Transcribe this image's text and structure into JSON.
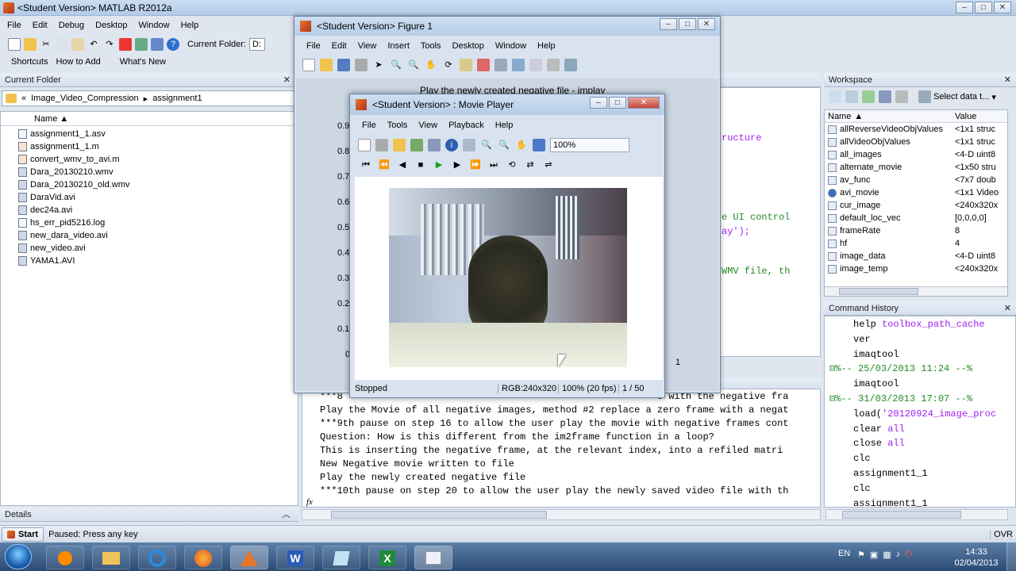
{
  "app": {
    "title": "<Student Version> MATLAB  R2012a"
  },
  "main_menu": [
    "File",
    "Edit",
    "Debug",
    "Desktop",
    "Window",
    "Help"
  ],
  "toolbar": {
    "current_folder_label": "Current Folder:",
    "current_folder_value": "D:"
  },
  "shortcuts": {
    "shortcuts_label": "Shortcuts",
    "how_to_add": "How to Add",
    "whats_new": "What's New"
  },
  "current_folder": {
    "title": "Current Folder",
    "path": [
      "Image_Video_Compression",
      "assignment1"
    ],
    "column_name": "Name",
    "files": [
      "assignment1_1.asv",
      "assignment1_1.m",
      "convert_wmv_to_avi.m",
      "Dara_20130210.wmv",
      "Dara_20130210_old.wmv",
      "DaraVid.avi",
      "dec24a.avi",
      "hs_err_pid5216.log",
      "new_dara_video.avi",
      "new_video.avi",
      "YAMA1.AVI"
    ],
    "details_label": "Details"
  },
  "figure": {
    "title": "<Student Version> Figure 1",
    "menu": [
      "File",
      "Edit",
      "View",
      "Insert",
      "Tools",
      "Desktop",
      "Window",
      "Help"
    ],
    "plot_title": "Play the newly created negative file - implay",
    "yticks": [
      "0.9",
      "0.8",
      "0.7",
      "0.6",
      "0.5",
      "0.4",
      "0.3",
      "0.2",
      "0.1",
      "0"
    ],
    "xtick_last": "1"
  },
  "movie_player": {
    "title": "<Student Version> : Movie Player",
    "menu": [
      "File",
      "Tools",
      "View",
      "Playback",
      "Help"
    ],
    "zoom": "100%",
    "status": "Stopped",
    "rgb": "RGB:240x320",
    "rate": "100% (20 fps)",
    "frame": "1 / 50"
  },
  "editor_fragments": [
    "ructure",
    "e UI control",
    "ay');",
    "WMV file, th"
  ],
  "command_window": {
    "lines": [
      "***8",
      "Play the Movie of all negative images, method #2 replace a zero frame with a negat",
      "***9th pause on step 16 to allow the user play the movie with negative frames cont",
      "Question: How is this different from the im2frame function in a loop?",
      "This is inserting the negative frame, at the relevant index, into a refiled matri",
      "New Negative movie written to file",
      "Play the newly created negative file",
      "***10th pause on step 20 to allow the user play the newly saved video file with th"
    ],
    "line0_tail": "e with the negative fra",
    "fx": "fx"
  },
  "workspace": {
    "title": "Workspace",
    "select_data": "Select data t...",
    "col_name": "Name",
    "col_value": "Value",
    "rows": [
      {
        "name": "allReverseVideoObjValues",
        "value": "<1x1 struc"
      },
      {
        "name": "allVideoObjValues",
        "value": "<1x1 struc"
      },
      {
        "name": "all_images",
        "value": "<4-D uint8"
      },
      {
        "name": "alternate_movie",
        "value": "<1x50 stru"
      },
      {
        "name": "av_func",
        "value": "<7x7 doub"
      },
      {
        "name": "avi_movie",
        "value": "<1x1 Video"
      },
      {
        "name": "cur_image",
        "value": "<240x320x"
      },
      {
        "name": "default_loc_vec",
        "value": "[0,0,0,0]"
      },
      {
        "name": "frameRate",
        "value": "8"
      },
      {
        "name": "hf",
        "value": "4"
      },
      {
        "name": "image_data",
        "value": "<4-D uint8"
      },
      {
        "name": "image_temp",
        "value": "<240x320x"
      }
    ]
  },
  "command_history": {
    "title": "Command History",
    "rows": [
      {
        "indent": 1,
        "parts": [
          {
            "t": "help ",
            "c": "#000"
          },
          {
            "t": "toolbox_path_cache",
            "c": "#a020f0"
          }
        ]
      },
      {
        "indent": 1,
        "parts": [
          {
            "t": "ver",
            "c": "#000"
          }
        ]
      },
      {
        "indent": 1,
        "parts": [
          {
            "t": "imaqtool",
            "c": "#000"
          }
        ]
      },
      {
        "indent": 0,
        "parts": [
          {
            "t": "⊟%-- 25/03/2013 11:24 --%",
            "c": "#228b22"
          }
        ]
      },
      {
        "indent": 1,
        "parts": [
          {
            "t": "imaqtool",
            "c": "#000"
          }
        ]
      },
      {
        "indent": 0,
        "parts": [
          {
            "t": "⊟%-- 31/03/2013 17:07 --%",
            "c": "#228b22"
          }
        ]
      },
      {
        "indent": 1,
        "parts": [
          {
            "t": "load(",
            "c": "#000"
          },
          {
            "t": "'20120924_image_proc",
            "c": "#a020f0"
          }
        ]
      },
      {
        "indent": 1,
        "parts": [
          {
            "t": "clear ",
            "c": "#000"
          },
          {
            "t": "all",
            "c": "#a020f0"
          }
        ]
      },
      {
        "indent": 1,
        "parts": [
          {
            "t": "close ",
            "c": "#000"
          },
          {
            "t": "all",
            "c": "#a020f0"
          }
        ]
      },
      {
        "indent": 1,
        "parts": [
          {
            "t": "clc",
            "c": "#000"
          }
        ]
      },
      {
        "indent": 1,
        "parts": [
          {
            "t": "assignment1_1",
            "c": "#000"
          }
        ]
      },
      {
        "indent": 1,
        "parts": [
          {
            "t": "clc",
            "c": "#000"
          }
        ]
      },
      {
        "indent": 1,
        "parts": [
          {
            "t": "assignment1_1",
            "c": "#000"
          }
        ]
      }
    ]
  },
  "statusbar": {
    "start": "Start",
    "status": "Paused: Press any key",
    "ovr": "OVR"
  },
  "taskbar": {
    "lang": "EN",
    "time": "14:33",
    "date": "02/04/2013"
  }
}
